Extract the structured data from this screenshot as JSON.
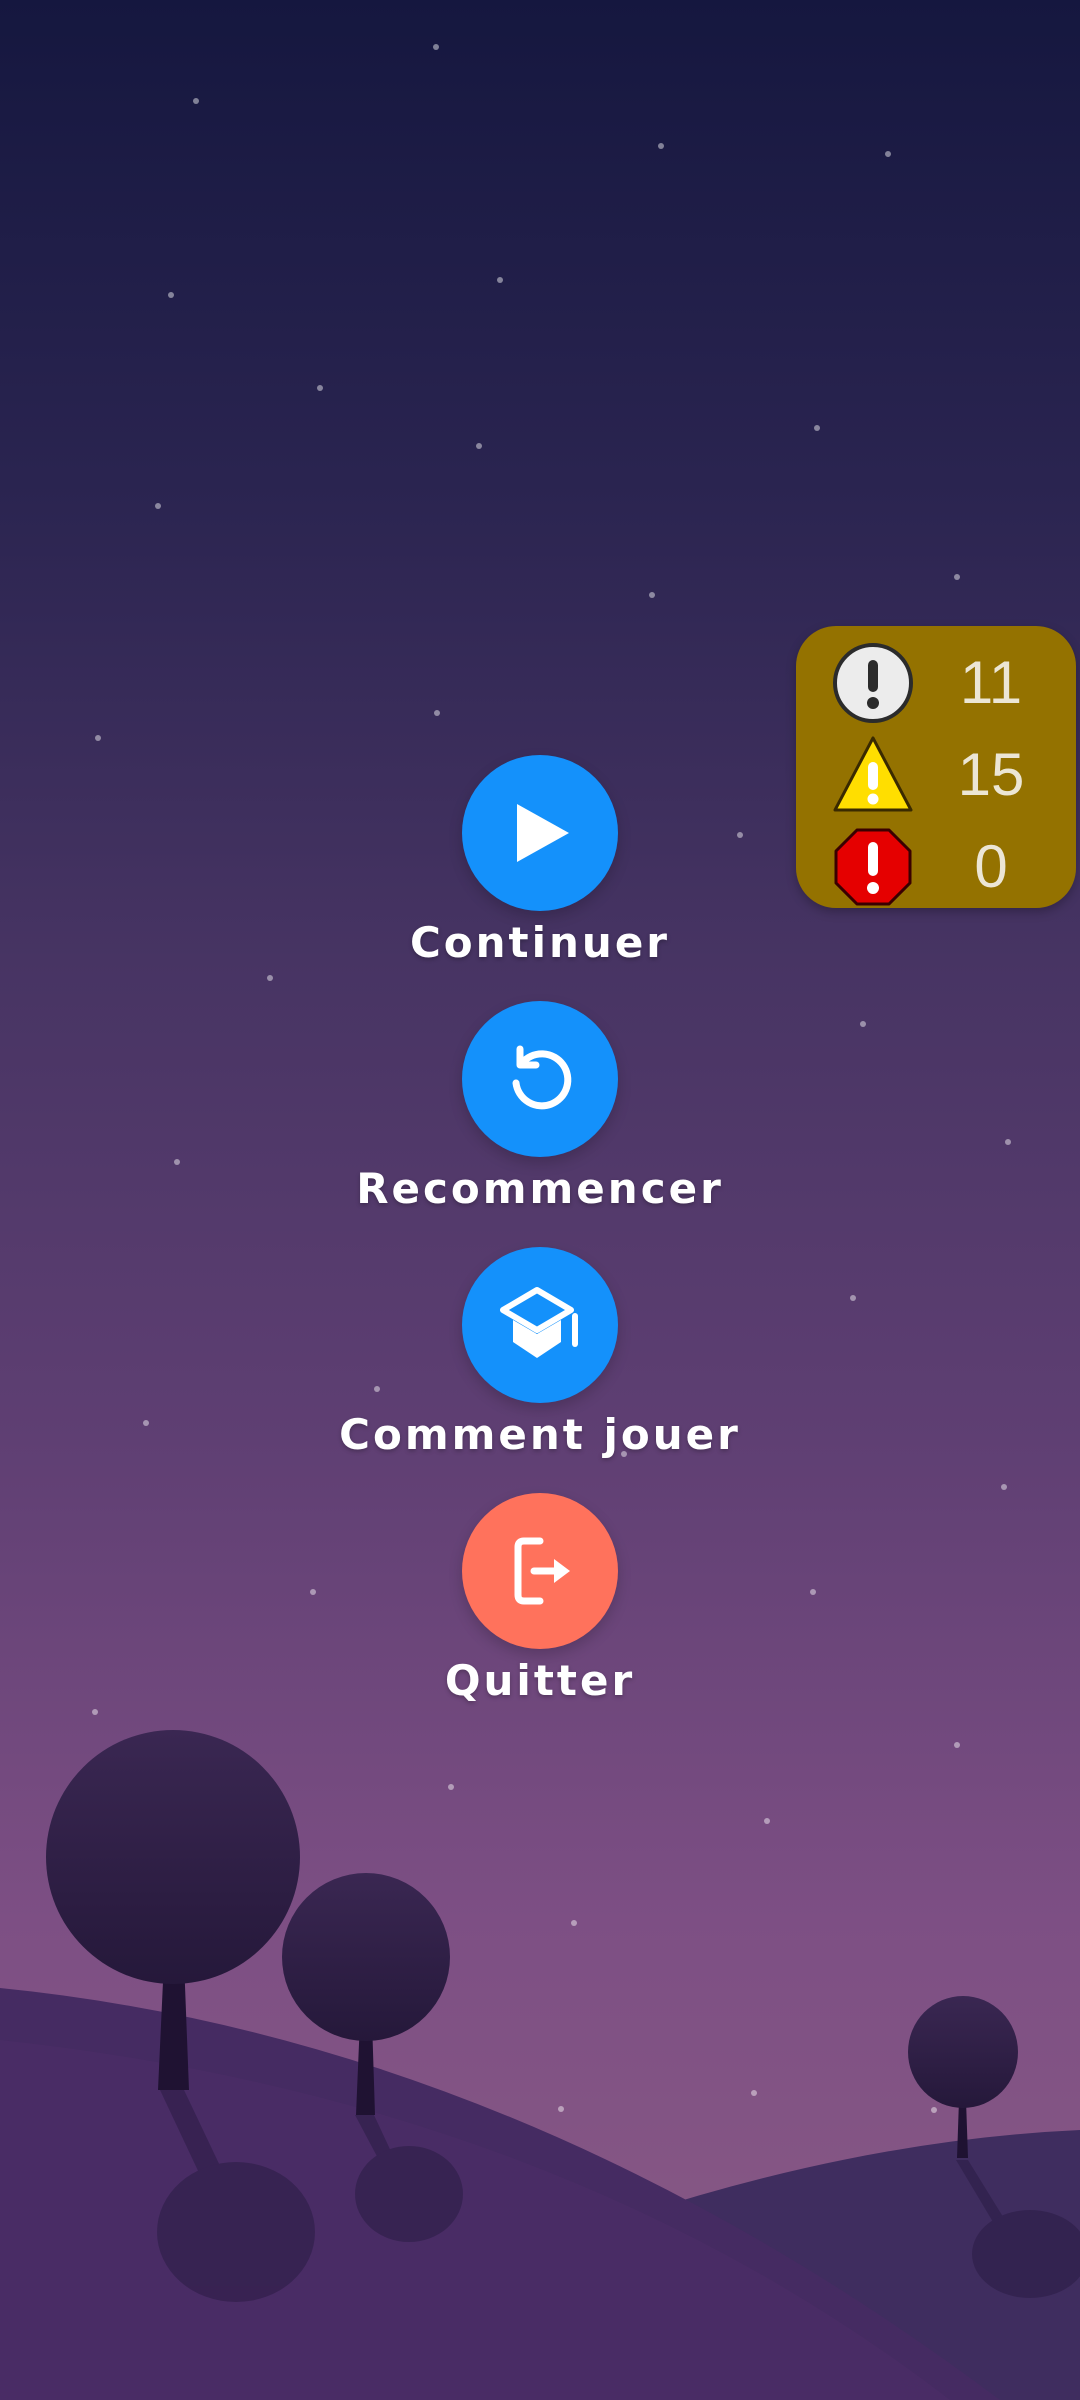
{
  "theme": {
    "primary_button_color": "#1491fb",
    "quit_button_color": "#ff725c",
    "hud_background": "#947200"
  },
  "menu": {
    "items": [
      {
        "icon": "play-icon",
        "label": "Continuer"
      },
      {
        "icon": "restart-icon",
        "label": "Recommencer"
      },
      {
        "icon": "graduation-cap-icon",
        "label": "Comment jouer"
      },
      {
        "icon": "exit-icon",
        "label": "Quitter"
      }
    ]
  },
  "hud": {
    "info_count": "11",
    "warning_count": "15",
    "error_count": "0"
  }
}
